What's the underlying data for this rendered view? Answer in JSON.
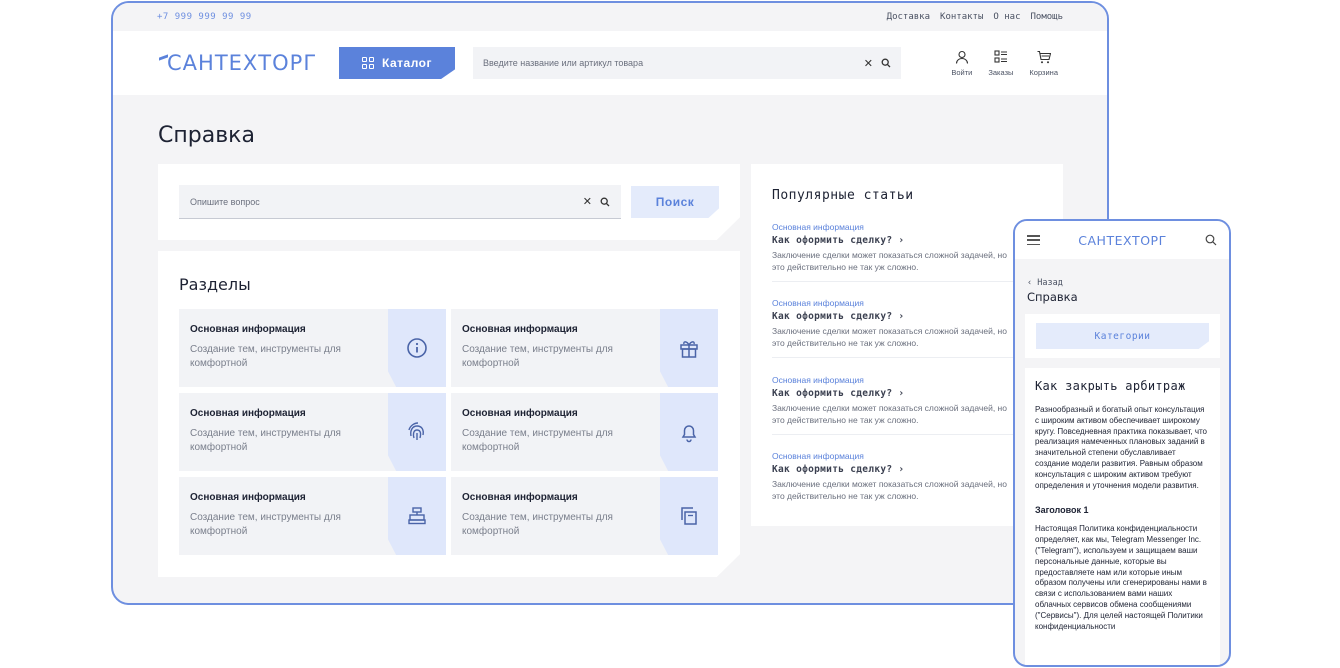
{
  "desktop": {
    "topbar": {
      "phone": "+7 999 999 99 99",
      "links": [
        "Доставка",
        "Контакты",
        "О нас",
        "Помощь"
      ]
    },
    "header": {
      "logo": "САНТЕХТОРГ",
      "catalog_label": "Каталог",
      "search_placeholder": "Введите название или артикул товара",
      "actions": {
        "login": "Войти",
        "orders": "Заказы",
        "cart": "Корзина"
      }
    },
    "page_title": "Справка",
    "help_search": {
      "placeholder": "Опишите вопрос",
      "button": "Поиск"
    },
    "sections": {
      "title": "Разделы",
      "tiles": [
        {
          "title": "Основная информация",
          "desc": "Создание тем, инструменты для комфортной",
          "icon": "info-icon"
        },
        {
          "title": "Основная информация",
          "desc": "Создание тем, инструменты для комфортной",
          "icon": "gift-icon"
        },
        {
          "title": "Основная информация",
          "desc": "Создание тем, инструменты для комфортной",
          "icon": "fingerprint-icon"
        },
        {
          "title": "Основная информация",
          "desc": "Создание тем, инструменты для комфортной",
          "icon": "bell-icon"
        },
        {
          "title": "Основная информация",
          "desc": "Создание тем, инструменты для комфортной",
          "icon": "cash-register-icon"
        },
        {
          "title": "Основная информация",
          "desc": "Создание тем, инструменты для комфортной",
          "icon": "copy-icon"
        }
      ]
    },
    "popular": {
      "title": "Популярные статьи",
      "articles": [
        {
          "category": "Основная информация",
          "title": "Как оформить сделку? ›",
          "desc1": "Заключение сделки может показаться сложной задачей, но",
          "desc2": "это действительно не так уж сложно."
        },
        {
          "category": "Основная информация",
          "title": "Как оформить сделку? ›",
          "desc1": "Заключение сделки может показаться сложной задачей, но",
          "desc2": "это действительно не так уж сложно."
        },
        {
          "category": "Основная информация",
          "title": "Как оформить сделку? ›",
          "desc1": "Заключение сделки может показаться сложной задачей, но",
          "desc2": "это действительно не так уж сложно."
        },
        {
          "category": "Основная информация",
          "title": "Как оформить сделку? ›",
          "desc1": "Заключение сделки может показаться сложной задачей, но",
          "desc2": "это действительно не так уж сложно."
        }
      ]
    }
  },
  "mobile": {
    "logo": "САНТЕХТОРГ",
    "back": "‹ Назад",
    "title": "Справка",
    "categories_button": "Категории",
    "article": {
      "heading": "Как закрыть арбитраж",
      "p1": "Разнообразный и богатый опыт консультация с широким активом обеспечивает широкому кругу. Повседневная практика показывает, что реализация намеченных плановых заданий в значительной степени обуславливает создание модели развития. Равным образом консультация с широким активом требуют определения и уточнения модели развития.",
      "subheading": "Заголовок 1",
      "p2": "Настоящая Политика конфиденциальности определяет, как мы, Telegram Messenger Inc. (\"Telegram\"), используем и защищаем ваши персональные данные, которые вы предоставляете нам или которые иным образом получены или сгенерированы нами в связи с использованием вами наших облачных сервисов обмена сообщениями (\"Сервисы\"). Для целей настоящей Политики конфиденциальности"
    }
  },
  "colors": {
    "accent": "#5b82db",
    "frame": "#6e8fe0",
    "tile_bg": "#f2f3f6",
    "icon_bg": "#dfe7fb"
  }
}
